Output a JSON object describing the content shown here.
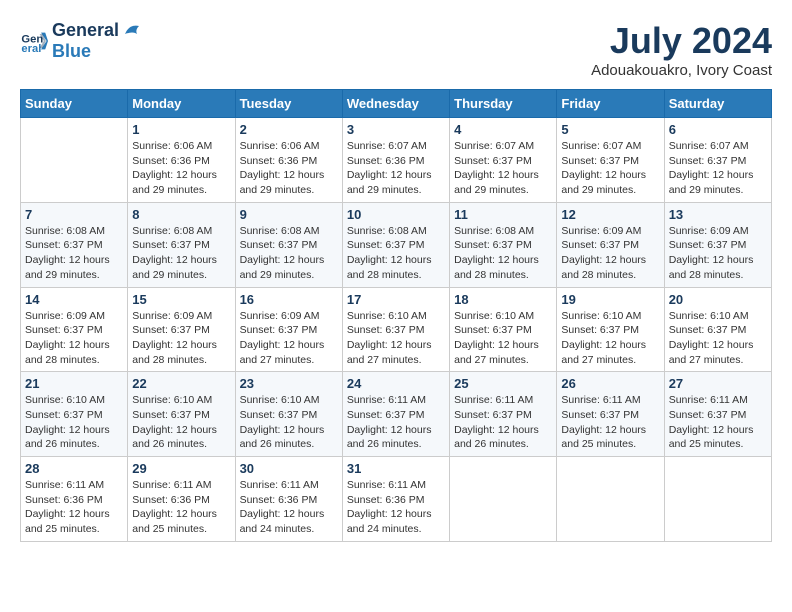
{
  "header": {
    "logo_line1": "General",
    "logo_line2": "Blue",
    "month": "July 2024",
    "location": "Adouakouakro, Ivory Coast"
  },
  "days_of_week": [
    "Sunday",
    "Monday",
    "Tuesday",
    "Wednesday",
    "Thursday",
    "Friday",
    "Saturday"
  ],
  "weeks": [
    [
      {
        "day": "",
        "info": ""
      },
      {
        "day": "1",
        "info": "Sunrise: 6:06 AM\nSunset: 6:36 PM\nDaylight: 12 hours\nand 29 minutes."
      },
      {
        "day": "2",
        "info": "Sunrise: 6:06 AM\nSunset: 6:36 PM\nDaylight: 12 hours\nand 29 minutes."
      },
      {
        "day": "3",
        "info": "Sunrise: 6:07 AM\nSunset: 6:36 PM\nDaylight: 12 hours\nand 29 minutes."
      },
      {
        "day": "4",
        "info": "Sunrise: 6:07 AM\nSunset: 6:37 PM\nDaylight: 12 hours\nand 29 minutes."
      },
      {
        "day": "5",
        "info": "Sunrise: 6:07 AM\nSunset: 6:37 PM\nDaylight: 12 hours\nand 29 minutes."
      },
      {
        "day": "6",
        "info": "Sunrise: 6:07 AM\nSunset: 6:37 PM\nDaylight: 12 hours\nand 29 minutes."
      }
    ],
    [
      {
        "day": "7",
        "info": "Sunrise: 6:08 AM\nSunset: 6:37 PM\nDaylight: 12 hours\nand 29 minutes."
      },
      {
        "day": "8",
        "info": "Sunrise: 6:08 AM\nSunset: 6:37 PM\nDaylight: 12 hours\nand 29 minutes."
      },
      {
        "day": "9",
        "info": "Sunrise: 6:08 AM\nSunset: 6:37 PM\nDaylight: 12 hours\nand 29 minutes."
      },
      {
        "day": "10",
        "info": "Sunrise: 6:08 AM\nSunset: 6:37 PM\nDaylight: 12 hours\nand 28 minutes."
      },
      {
        "day": "11",
        "info": "Sunrise: 6:08 AM\nSunset: 6:37 PM\nDaylight: 12 hours\nand 28 minutes."
      },
      {
        "day": "12",
        "info": "Sunrise: 6:09 AM\nSunset: 6:37 PM\nDaylight: 12 hours\nand 28 minutes."
      },
      {
        "day": "13",
        "info": "Sunrise: 6:09 AM\nSunset: 6:37 PM\nDaylight: 12 hours\nand 28 minutes."
      }
    ],
    [
      {
        "day": "14",
        "info": "Sunrise: 6:09 AM\nSunset: 6:37 PM\nDaylight: 12 hours\nand 28 minutes."
      },
      {
        "day": "15",
        "info": "Sunrise: 6:09 AM\nSunset: 6:37 PM\nDaylight: 12 hours\nand 28 minutes."
      },
      {
        "day": "16",
        "info": "Sunrise: 6:09 AM\nSunset: 6:37 PM\nDaylight: 12 hours\nand 27 minutes."
      },
      {
        "day": "17",
        "info": "Sunrise: 6:10 AM\nSunset: 6:37 PM\nDaylight: 12 hours\nand 27 minutes."
      },
      {
        "day": "18",
        "info": "Sunrise: 6:10 AM\nSunset: 6:37 PM\nDaylight: 12 hours\nand 27 minutes."
      },
      {
        "day": "19",
        "info": "Sunrise: 6:10 AM\nSunset: 6:37 PM\nDaylight: 12 hours\nand 27 minutes."
      },
      {
        "day": "20",
        "info": "Sunrise: 6:10 AM\nSunset: 6:37 PM\nDaylight: 12 hours\nand 27 minutes."
      }
    ],
    [
      {
        "day": "21",
        "info": "Sunrise: 6:10 AM\nSunset: 6:37 PM\nDaylight: 12 hours\nand 26 minutes."
      },
      {
        "day": "22",
        "info": "Sunrise: 6:10 AM\nSunset: 6:37 PM\nDaylight: 12 hours\nand 26 minutes."
      },
      {
        "day": "23",
        "info": "Sunrise: 6:10 AM\nSunset: 6:37 PM\nDaylight: 12 hours\nand 26 minutes."
      },
      {
        "day": "24",
        "info": "Sunrise: 6:11 AM\nSunset: 6:37 PM\nDaylight: 12 hours\nand 26 minutes."
      },
      {
        "day": "25",
        "info": "Sunrise: 6:11 AM\nSunset: 6:37 PM\nDaylight: 12 hours\nand 26 minutes."
      },
      {
        "day": "26",
        "info": "Sunrise: 6:11 AM\nSunset: 6:37 PM\nDaylight: 12 hours\nand 25 minutes."
      },
      {
        "day": "27",
        "info": "Sunrise: 6:11 AM\nSunset: 6:37 PM\nDaylight: 12 hours\nand 25 minutes."
      }
    ],
    [
      {
        "day": "28",
        "info": "Sunrise: 6:11 AM\nSunset: 6:36 PM\nDaylight: 12 hours\nand 25 minutes."
      },
      {
        "day": "29",
        "info": "Sunrise: 6:11 AM\nSunset: 6:36 PM\nDaylight: 12 hours\nand 25 minutes."
      },
      {
        "day": "30",
        "info": "Sunrise: 6:11 AM\nSunset: 6:36 PM\nDaylight: 12 hours\nand 24 minutes."
      },
      {
        "day": "31",
        "info": "Sunrise: 6:11 AM\nSunset: 6:36 PM\nDaylight: 12 hours\nand 24 minutes."
      },
      {
        "day": "",
        "info": ""
      },
      {
        "day": "",
        "info": ""
      },
      {
        "day": "",
        "info": ""
      }
    ]
  ]
}
